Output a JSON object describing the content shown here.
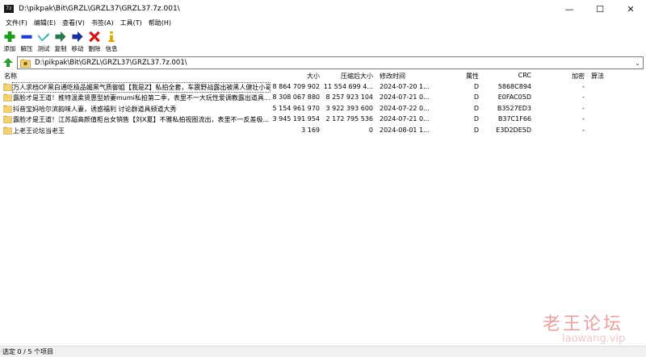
{
  "window": {
    "app_icon": "7z",
    "title": "D:\\pikpak\\Bit\\GRZL\\GRZL37\\GRZL37.7z.001\\",
    "minimize": "—",
    "maximize": "☐",
    "close": "✕"
  },
  "menu": [
    "文件(F)",
    "编辑(E)",
    "查看(V)",
    "书签(A)",
    "工具(T)",
    "帮助(H)"
  ],
  "toolbar": {
    "add": "添加",
    "extract": "解压",
    "test": "测试",
    "copy": "复制",
    "move": "移动",
    "delete": "删除",
    "info": "信息"
  },
  "colors": {
    "add": "#1a9b1a",
    "extract": "#1f3fc4",
    "test": "#1aa6a6",
    "copy": "#2c7a4a",
    "move": "#1b2f9c",
    "delete": "#d01515",
    "info": "#d8a800",
    "folder": "#f5d271"
  },
  "address": "D:\\pikpak\\Bit\\GRZL\\GRZL37\\GRZL37.7z.001\\",
  "columns": {
    "name": "名称",
    "size": "大小",
    "packed": "压缩后大小",
    "modified": "修改时间",
    "attr": "属性",
    "crc": "CRC",
    "encrypted": "加密",
    "method": "算法"
  },
  "rows": [
    {
      "name": "万人求档OF黑白通吃极品媚黑气质御姐【我是Z】私拍全套，车震野战露出被黑人健壮小哥",
      "size": "8 864 709 902",
      "packed": "11 554 699 4...",
      "modified": "2024-07-20 1...",
      "attr": "D",
      "crc": "5868C894",
      "enc": "-"
    },
    {
      "name": "露脸才是王道！推特温柔贤惠型娇妻mumi私拍第二季，表里不一大玩性爱调教露出道具...",
      "size": "8 308 067 880",
      "packed": "8 257 923 104",
      "modified": "2024-07-21 0...",
      "attr": "D",
      "crc": "E0FAC05D",
      "enc": "-"
    },
    {
      "name": "抖音宝妈哈尔滨韵味人妻，诱惑福利 讨论群道具频道大秀",
      "size": "5 154 961 970",
      "packed": "3 922 393 600",
      "modified": "2024-07-22 0...",
      "attr": "D",
      "crc": "B3527ED3",
      "enc": "-"
    },
    {
      "name": "露脸才是王道！江苏超高颜值柜台女销售【刘X夏】不雅私拍视图流出，表里不一反差极...",
      "size": "3 945 191 954",
      "packed": "2 172 795 536",
      "modified": "2024-07-21 0...",
      "attr": "D",
      "crc": "B37C1F66",
      "enc": "-"
    },
    {
      "name": "上老王论坛当老王",
      "size": "3 169",
      "packed": "0",
      "modified": "2024-08-01 1...",
      "attr": "D",
      "crc": "E3D2DE5D",
      "enc": "-"
    }
  ],
  "status": "选定 0 / 5 个项目",
  "watermark": {
    "text1": "老王论坛",
    "text2": "laowang.vip"
  }
}
